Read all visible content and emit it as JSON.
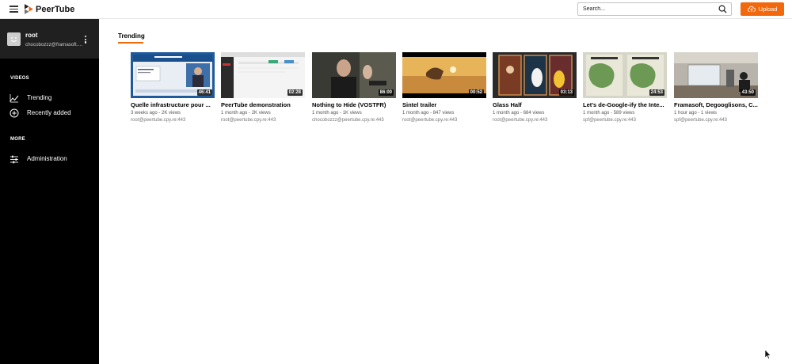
{
  "header": {
    "logo_text": "PeerTube",
    "search_placeholder": "Search...",
    "upload_label": "Upload"
  },
  "user": {
    "name": "root",
    "handle": "chocobozzz@framasoft.org"
  },
  "sidebar": {
    "videos_section": "VIDEOS",
    "items": [
      {
        "label": "Trending",
        "icon": "trending-icon"
      },
      {
        "label": "Recently added",
        "icon": "plus-circle-icon"
      }
    ],
    "more_section": "MORE",
    "admin_label": "Administration"
  },
  "main": {
    "tab_label": "Trending",
    "videos": [
      {
        "title": "Quelle infrastructure pour ...",
        "meta": "3 weeks ago - 2K views",
        "author": "root@peertube.cpy.re:443",
        "duration": "46:41"
      },
      {
        "title": "PeerTube demonstration",
        "meta": "1 month ago - 2K views",
        "author": "root@peertube.cpy.re:443",
        "duration": "02:28"
      },
      {
        "title": "Nothing to Hide (VOSTFR)",
        "meta": "1 month ago - 1K views",
        "author": "chocobozzz@peertube.cpy.re:443",
        "duration": "86:00"
      },
      {
        "title": "Sintel trailer",
        "meta": "1 month ago - 847 views",
        "author": "root@peertube.cpy.re:443",
        "duration": "00:52"
      },
      {
        "title": "Glass Half",
        "meta": "1 month ago - 684 views",
        "author": "root@peertube.cpy.re:443",
        "duration": "03:13"
      },
      {
        "title": "Let's de-Google-ify the Inte...",
        "meta": "1 month ago - 589 views",
        "author": "spf@peertube.cpy.re:443",
        "duration": "24:53"
      },
      {
        "title": "Framasoft, Degooglisons, C...",
        "meta": "1 hour ago - 1 views",
        "author": "spf@peertube.cpy.re:443",
        "duration": "43:50"
      }
    ]
  },
  "colors": {
    "accent": "#f1680d",
    "sidebar_bg": "#000000",
    "user_block_bg": "#202020"
  }
}
